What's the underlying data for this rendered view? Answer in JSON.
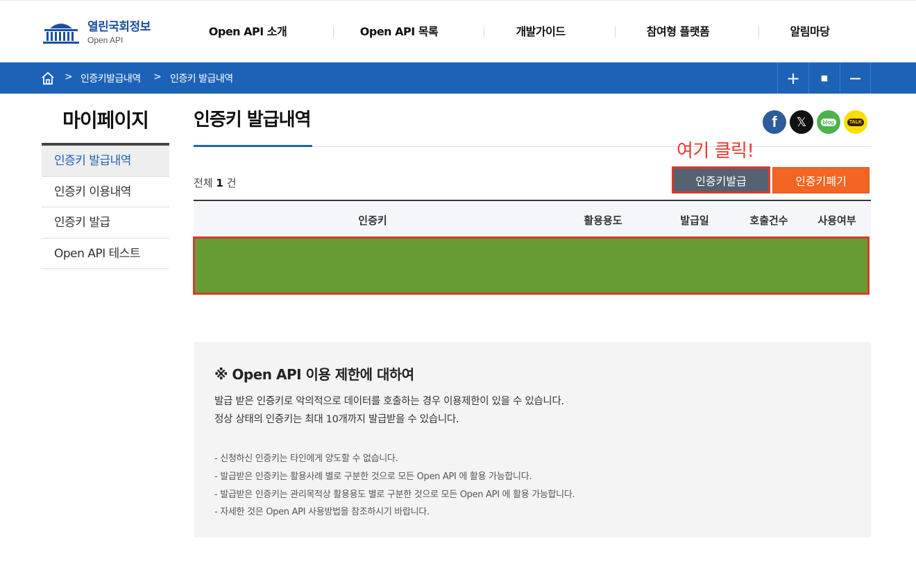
{
  "header": {
    "logo_main": "열린국회정보",
    "logo_sub": "Open API",
    "nav": [
      "Open API 소개",
      "Open API 목록",
      "개발가이드",
      "참여형 플랫폼",
      "알림마당"
    ]
  },
  "breadcrumb": {
    "sep": ">",
    "items": [
      "인증키발급내역",
      "인증키 발급내역"
    ],
    "zoom_in": "+",
    "zoom_reset": "■",
    "zoom_out": "−"
  },
  "sidebar": {
    "title": "마이페이지",
    "items": [
      {
        "label": "인증키 발급내역",
        "active": true
      },
      {
        "label": "인증키 이용내역",
        "active": false
      },
      {
        "label": "인증키 발급",
        "active": false
      },
      {
        "label": "Open API 테스트",
        "active": false
      }
    ]
  },
  "content": {
    "title": "인증키 발급내역",
    "annotation": "여기 클릭!",
    "total_prefix": "전체",
    "total_count": "1",
    "total_suffix": "건",
    "issue_button": "인증키발급",
    "revoke_button": "인증키폐기",
    "table_headers": [
      "인증키",
      "활용용도",
      "발급일",
      "호출건수",
      "사용여부"
    ]
  },
  "social": {
    "facebook": "f",
    "x": "𝕏",
    "blog": "blog",
    "talk": "TALK"
  },
  "notice": {
    "title": "※ Open API 이용 제한에 대하여",
    "lines": [
      "발급 받은 인증키로 악의적으로 데이터를 호출하는 경우 이용제한이 있을 수 있습니다.",
      "정상 상태의 인증키는 최대 10개까지 발급받을 수 있습니다."
    ],
    "bullets": [
      "- 신청하신 인증키는 타인에게 양도할 수 없습니다.",
      "- 발급받은 인증키는 활용사례 별로 구분한 것으로 모든 Open API 에 활용 가능합니다.",
      "- 발급받은 인증키는 관리목적상 활용용도 별로 구분한 것으로 모든 Open API 에 활용 가능합니다.",
      "- 자세한 것은 Open API 사용방법을 참조하시기 바랍니다."
    ]
  },
  "colors": {
    "primary_blue": "#1c63b7",
    "issue_button_bg": "#556070",
    "revoke_button_bg": "#f26522",
    "highlight_red": "#d83a2a",
    "row_green": "#679c33"
  }
}
